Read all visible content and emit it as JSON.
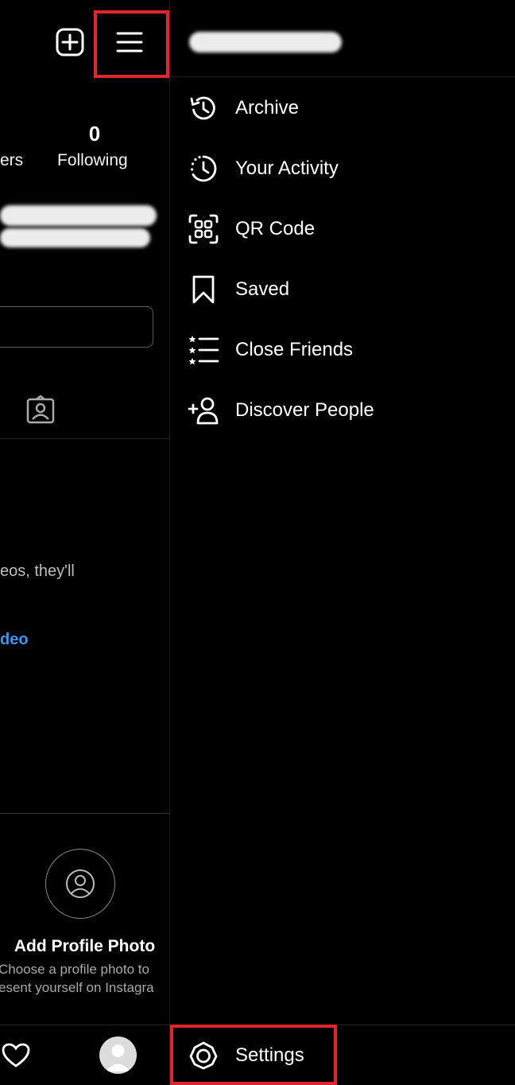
{
  "profile": {
    "following_count": "0",
    "followers_label_partial": "ers",
    "following_label": "Following",
    "posts_empty_text": "eos, they'll",
    "share_link_text": "deo",
    "add_photo_title": "Add Profile Photo",
    "add_photo_desc_line1": "Choose a profile photo to",
    "add_photo_desc_line2": "esent yourself on Instagra"
  },
  "drawer": {
    "menu": [
      {
        "label": "Archive",
        "icon": "archive-icon"
      },
      {
        "label": "Your Activity",
        "icon": "activity-icon"
      },
      {
        "label": "QR Code",
        "icon": "qr-code-icon"
      },
      {
        "label": "Saved",
        "icon": "bookmark-icon"
      },
      {
        "label": "Close Friends",
        "icon": "close-friends-icon"
      },
      {
        "label": "Discover People",
        "icon": "add-person-icon"
      }
    ],
    "settings_label": "Settings"
  },
  "colors": {
    "background": "#000000",
    "highlight": "#e0252f",
    "link": "#3897f0"
  }
}
